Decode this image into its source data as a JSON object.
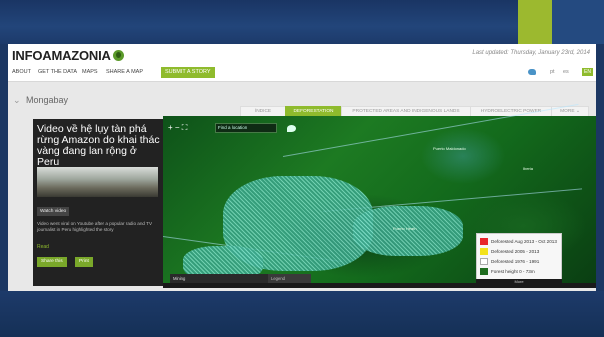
{
  "site": {
    "logo": "INFOAMAZONIA",
    "last_updated": "Last updated: Thursday, January 23rd, 2014"
  },
  "nav": {
    "items": [
      "ABOUT",
      "GET THE DATA",
      "MAPS",
      "SHARE A MAP"
    ],
    "submit": "SUBMIT A STORY",
    "languages": [
      "pt",
      "es",
      "EN"
    ]
  },
  "page": {
    "title": "Mongabay",
    "chevron": "⌄"
  },
  "tabs": [
    {
      "label": "ÍNDICE",
      "active": false
    },
    {
      "label": "DEFORESTATION",
      "active": true
    },
    {
      "label": "PROTECTED AREAS AND INDIGENOUS LANDS",
      "active": false
    },
    {
      "label": "HYDROELECTRIC POWER",
      "active": false
    },
    {
      "label": "MORE ⌄",
      "active": false
    }
  ],
  "map": {
    "tools": "+ − ⛶",
    "search_placeholder": "Find a location",
    "cities": [
      "Puerto Maldonado",
      "Iberia",
      "Puerto Heath"
    ]
  },
  "story": {
    "title": "Video về hệ lụy tàn phá rừng Amazon do khai thác vàng đang lan rộng ở Peru",
    "watch_label": "Watch video",
    "description": "Video went viral on Youtube after a popular radio and TV journalist in Peru highlighted the story",
    "read_label": "Read",
    "share_label": "Share this",
    "print_label": "Print"
  },
  "layer_bar": {
    "label": "Mining",
    "sub": "Deforestation 2013",
    "extra": "Legend"
  },
  "legend": {
    "items": [
      {
        "label": "Deforested Aug 2013 - Oct 2013",
        "color": "#e8262b"
      },
      {
        "label": "Deforested 2005 - 2013",
        "color": "#f3e21b"
      },
      {
        "label": "Deforested 1976 - 1991",
        "color": "#ffffff"
      },
      {
        "label": "Forest height 0 - 73m",
        "color": "#1f6d1f"
      }
    ],
    "footer": "More"
  },
  "colors": {
    "accent": "#8fbb2d",
    "slide_background": "#1c3763"
  }
}
